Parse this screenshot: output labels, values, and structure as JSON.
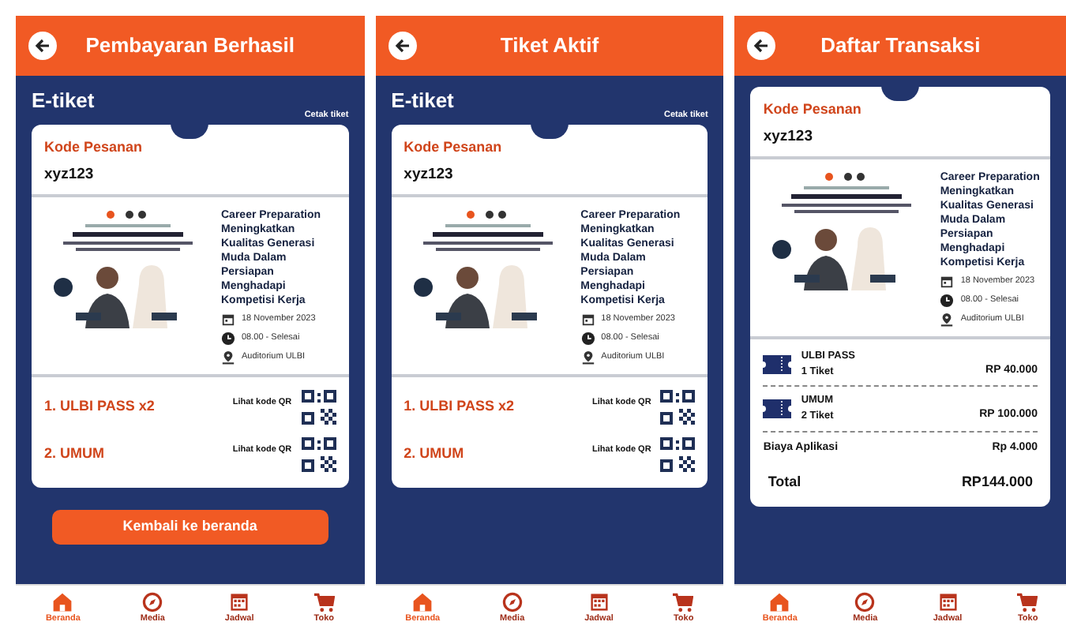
{
  "screens": [
    {
      "kind": "ticket",
      "title": "Pembayaran Berhasil",
      "heading": "E-tiket",
      "print_link": "Cetak tiket",
      "order_label": "Kode Pesanan",
      "order_code": "xyz123",
      "event": {
        "title": "Career Preparation Meningkatkan Kualitas Generasi Muda Dalam Persiapan Menghadapi Kompetisi Kerja",
        "date": "18 November 2023",
        "time": "08.00 - Selesai",
        "place": "Auditorium ULBI"
      },
      "tickets": [
        {
          "label": "1. ULBI PASS x2",
          "qr_link": "Lihat kode QR"
        },
        {
          "label": "2. UMUM",
          "qr_link": "Lihat kode QR"
        }
      ],
      "button": "Kembali ke beranda",
      "nav": [
        {
          "label": "Beranda",
          "selected": true
        },
        {
          "label": "Media",
          "selected": false
        },
        {
          "label": "Jadwal",
          "selected": false
        },
        {
          "label": "Toko",
          "selected": false
        }
      ]
    },
    {
      "kind": "ticket",
      "title": "Tiket Aktif",
      "heading": "E-tiket",
      "print_link": "Cetak tiket",
      "order_label": "Kode Pesanan",
      "order_code": "xyz123",
      "event": {
        "title": "Career Preparation Meningkatkan Kualitas Generasi Muda Dalam Persiapan Menghadapi Kompetisi Kerja",
        "date": "18 November 2023",
        "time": "08.00 - Selesai",
        "place": "Auditorium ULBI"
      },
      "tickets": [
        {
          "label": "1. ULBI PASS x2",
          "qr_link": "Lihat kode QR"
        },
        {
          "label": "2. UMUM",
          "qr_link": "Lihat kode QR"
        }
      ],
      "nav": [
        {
          "label": "Beranda",
          "selected": true
        },
        {
          "label": "Media",
          "selected": false
        },
        {
          "label": "Jadwal",
          "selected": false
        },
        {
          "label": "Toko",
          "selected": false
        }
      ]
    },
    {
      "kind": "transaction",
      "title": "Daftar Transaksi",
      "order_label": "Kode Pesanan",
      "order_code": "xyz123",
      "event": {
        "title": "Career Preparation Meningkatkan Kualitas Generasi Muda Dalam Persiapan Menghadapi Kompetisi Kerja",
        "date": "18 November 2023",
        "time": "08.00 - Selesai",
        "place": "Auditorium ULBI"
      },
      "items": [
        {
          "name": "ULBI PASS",
          "qty": "1 Tiket",
          "price": "RP 40.000"
        },
        {
          "name": "UMUM",
          "qty": "2 Tiket",
          "price": "RP 100.000"
        }
      ],
      "fee": {
        "label": "Biaya Aplikasi",
        "value": "Rp 4.000"
      },
      "total": {
        "label": "Total",
        "value": "RP144.000"
      },
      "nav": [
        {
          "label": "Beranda",
          "selected": true
        },
        {
          "label": "Media",
          "selected": false
        },
        {
          "label": "Jadwal",
          "selected": false
        },
        {
          "label": "Toko",
          "selected": false
        }
      ]
    }
  ]
}
